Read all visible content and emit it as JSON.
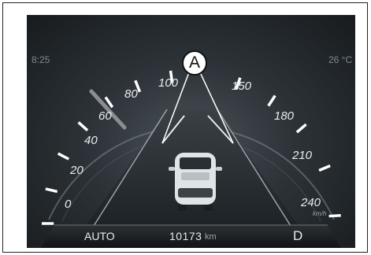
{
  "clock": "8:25",
  "temperature": "26 °C",
  "speed_labels": [
    "0",
    "20",
    "40",
    "60",
    "80",
    "100",
    "150",
    "180",
    "210",
    "240"
  ],
  "speed_unit": "km/h",
  "odometer": {
    "value": "10173",
    "unit": "km"
  },
  "drive_mode": "AUTO",
  "gear": "D",
  "callout_label": "A"
}
